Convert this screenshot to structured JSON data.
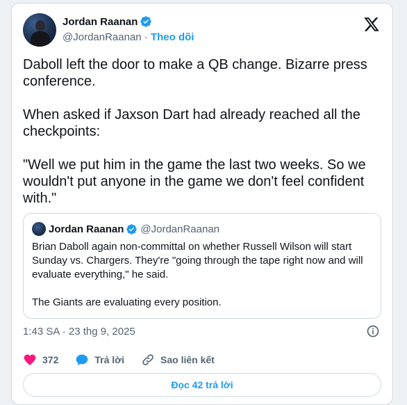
{
  "tweet": {
    "author_name": "Jordan Raanan",
    "author_handle": "@JordanRaanan",
    "separator": " · ",
    "follow_label": "Theo dõi",
    "text": "Daboll left the door to make a QB change. Bizarre press conference.\n\nWhen asked if Jaxson Dart had already reached all the checkpoints:\n\n\"Well we put him in the game the last two weeks. So we wouldn't put anyone in the game we don't feel confident with.\"",
    "timestamp": "1:43 SA · 23 thg 9, 2025"
  },
  "quote": {
    "author_name": "Jordan Raanan",
    "author_handle": "@JordanRaanan",
    "text": "Brian Daboll again non-committal on whether Russell Wilson will start Sunday vs. Chargers. They're \"going through the tape right now and will evaluate everything,\" he said.\n\nThe Giants are evaluating every position."
  },
  "actions": {
    "like_count": "372",
    "reply_label": "Trả lời",
    "copy_link_label": "Sao liên kết"
  },
  "read_replies_label": "Đọc 42 trả lời",
  "colors": {
    "accent": "#1d9bf0",
    "like": "#f91880",
    "text": "#0f1419",
    "muted": "#536471"
  },
  "icons": [
    "verified-badge-icon",
    "x-logo-icon",
    "info-icon",
    "heart-icon",
    "reply-bubble-icon",
    "link-icon"
  ]
}
